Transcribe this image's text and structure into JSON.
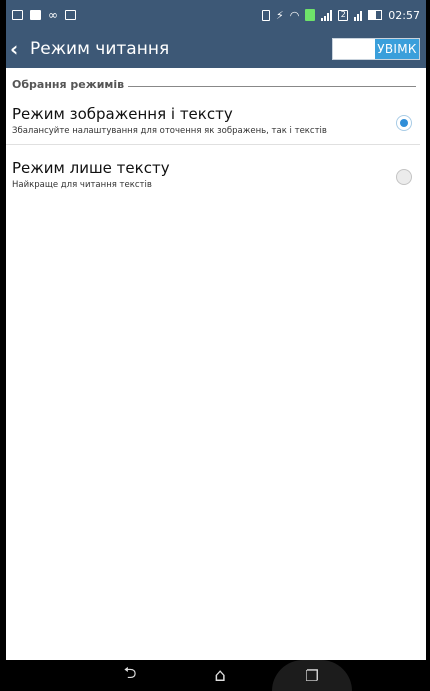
{
  "status_bar": {
    "time": "02:57",
    "network_badge": "2"
  },
  "app_bar": {
    "title": "Режим читання",
    "toggle_label": "УВІМК"
  },
  "section": {
    "header": "Обрання режимів"
  },
  "options": [
    {
      "title": "Режим зображення і тексту",
      "subtitle": "Збалансуйте налаштування для оточення як зображень, так і текстів",
      "selected": true
    },
    {
      "title": "Режим лише тексту",
      "subtitle": "Найкраще для читання текстів",
      "selected": false
    }
  ],
  "nav_bar": {
    "back_icon": "back-icon",
    "home_icon": "home-icon",
    "recents_icon": "recents-icon"
  },
  "colors": {
    "app_bar": "#3d5876",
    "toggle_on": "#3a9fdb",
    "radio_selected": "#2f8ed8"
  }
}
